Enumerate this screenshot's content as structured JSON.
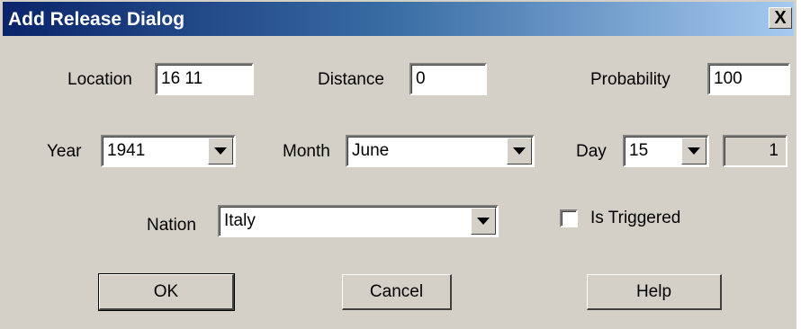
{
  "window": {
    "title": "Add Release Dialog",
    "close_glyph": "X"
  },
  "row1": {
    "location_label": "Location",
    "location_value": "16 11",
    "distance_label": "Distance",
    "distance_value": "0",
    "probability_label": "Probability",
    "probability_value": "100"
  },
  "row2": {
    "year_label": "Year",
    "year_value": "1941",
    "month_label": "Month",
    "month_value": "June",
    "day_label": "Day",
    "day_value": "15",
    "readonly_value": "1"
  },
  "row3": {
    "nation_label": "Nation",
    "nation_value": "Italy",
    "triggered_label": "Is Triggered",
    "triggered_checked": false
  },
  "buttons": {
    "ok": "OK",
    "cancel": "Cancel",
    "help": "Help"
  },
  "colors": {
    "face": "#d4d0c8",
    "title_start": "#0a246a",
    "title_end": "#a6caf0"
  }
}
